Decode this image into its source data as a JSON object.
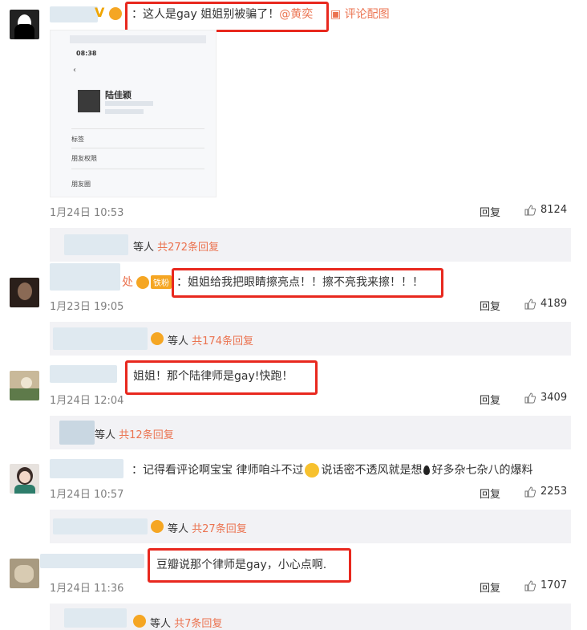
{
  "comments": [
    {
      "text": "：这人是gay 姐姐别被骗了！",
      "mention": "@黄奕",
      "pic_action": "评论配图",
      "date": "1月24日 10:53",
      "reply": "回复",
      "likes": "8124",
      "sub": {
        "prefix": "等人",
        "count": "共272条回复"
      }
    },
    {
      "name_suffix": "处",
      "badge_text": "铁粉",
      "text": "：姐姐给我把眼睛擦亮点！！擦不亮我来擦！！！",
      "date": "1月23日 19:05",
      "reply": "回复",
      "likes": "4189",
      "sub": {
        "prefix": "等人",
        "count": "共174条回复"
      }
    },
    {
      "text": "姐姐！那个陆律师是gay!快跑！",
      "date": "1月24日 12:04",
      "reply": "回复",
      "likes": "3409",
      "sub": {
        "prefix": "等人",
        "count": "共12条回复"
      }
    },
    {
      "text": "：记得看评论啊宝宝 律师咱斗不过",
      "text2": "说话密不透风就是想",
      "text3": "好多杂七杂八的爆料",
      "date": "1月24日 10:57",
      "reply": "回复",
      "likes": "2253",
      "sub": {
        "prefix": "等人",
        "count": "共27条回复"
      }
    },
    {
      "text": "豆瓣说那个律师是gay，小心点啊.",
      "date": "1月24日 11:36",
      "reply": "回复",
      "likes": "1707",
      "sub": {
        "prefix": "等人",
        "count": "共7条回复"
      }
    }
  ],
  "pic": {
    "time": "08:38",
    "name": "陆佳颖",
    "row_tag": "标签",
    "row_friends": "朋友权限",
    "row_moments": "朋友圈"
  },
  "colors": {
    "accent": "#eb7350",
    "highlight_box": "#e8281e",
    "sub_bg": "#f2f2f5"
  },
  "icons": [
    "image-icon",
    "thumb-up-icon",
    "crown-badge-icon",
    "fire-icon",
    "emoji-icon"
  ]
}
